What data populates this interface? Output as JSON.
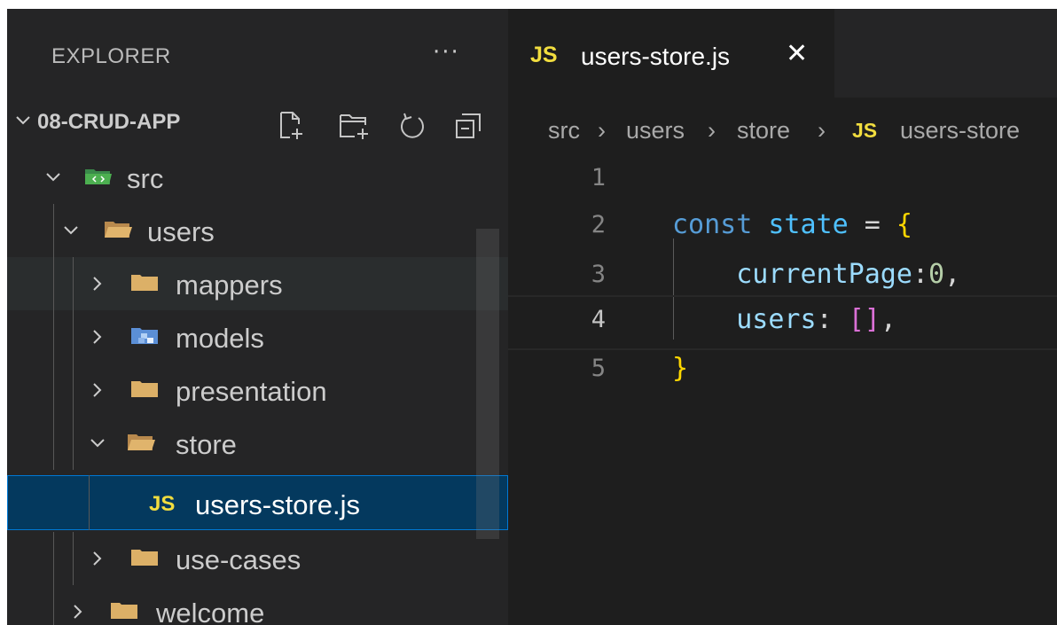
{
  "explorer": {
    "title": "EXPLORER",
    "more": "···",
    "project": "08-CRUD-APP",
    "actions": [
      "new-file-icon",
      "new-folder-icon",
      "refresh-icon",
      "collapse-all-icon"
    ]
  },
  "tree": [
    {
      "label": "src",
      "icon": "src-folder-icon",
      "expanded": true
    },
    {
      "label": "users",
      "icon": "folder-open-icon",
      "expanded": true
    },
    {
      "label": "mappers",
      "icon": "folder-icon",
      "expanded": false
    },
    {
      "label": "models",
      "icon": "models-folder-icon",
      "expanded": false
    },
    {
      "label": "presentation",
      "icon": "folder-icon",
      "expanded": false
    },
    {
      "label": "store",
      "icon": "folder-open-icon",
      "expanded": true
    },
    {
      "label": "users-store.js",
      "icon": "js-file-icon",
      "badge": "JS",
      "selected": true
    },
    {
      "label": "use-cases",
      "icon": "folder-icon",
      "expanded": false
    },
    {
      "label": "welcome",
      "icon": "folder-icon",
      "expanded": false
    }
  ],
  "editor": {
    "tab": {
      "badge": "JS",
      "label": "users-store.js",
      "close": "✕"
    },
    "breadcrumb": {
      "parts": [
        "src",
        "users",
        "store",
        "users-store"
      ],
      "separator": "›",
      "file_badge": "JS"
    },
    "line_numbers": [
      "1",
      "2",
      "3",
      "4",
      "5"
    ],
    "current_line": 4,
    "code": {
      "l2": {
        "kw": "const",
        "name": "state",
        "eq": "=",
        "open": "{"
      },
      "l3": {
        "prop": "currentPage",
        "colon": ":",
        "num": "0",
        "comma": ","
      },
      "l4": {
        "prop": "users",
        "colon": ":",
        "open": "[",
        "close": "]",
        "comma": ","
      },
      "l5": {
        "close": "}"
      }
    }
  },
  "colors": {
    "accent": "#0078d4",
    "js_badge": "#f1dd3f",
    "folder": "#c09553",
    "keyword": "#569cd6",
    "variable": "#4fc1ff",
    "property": "#9cdcfe",
    "number": "#b5cea8"
  }
}
